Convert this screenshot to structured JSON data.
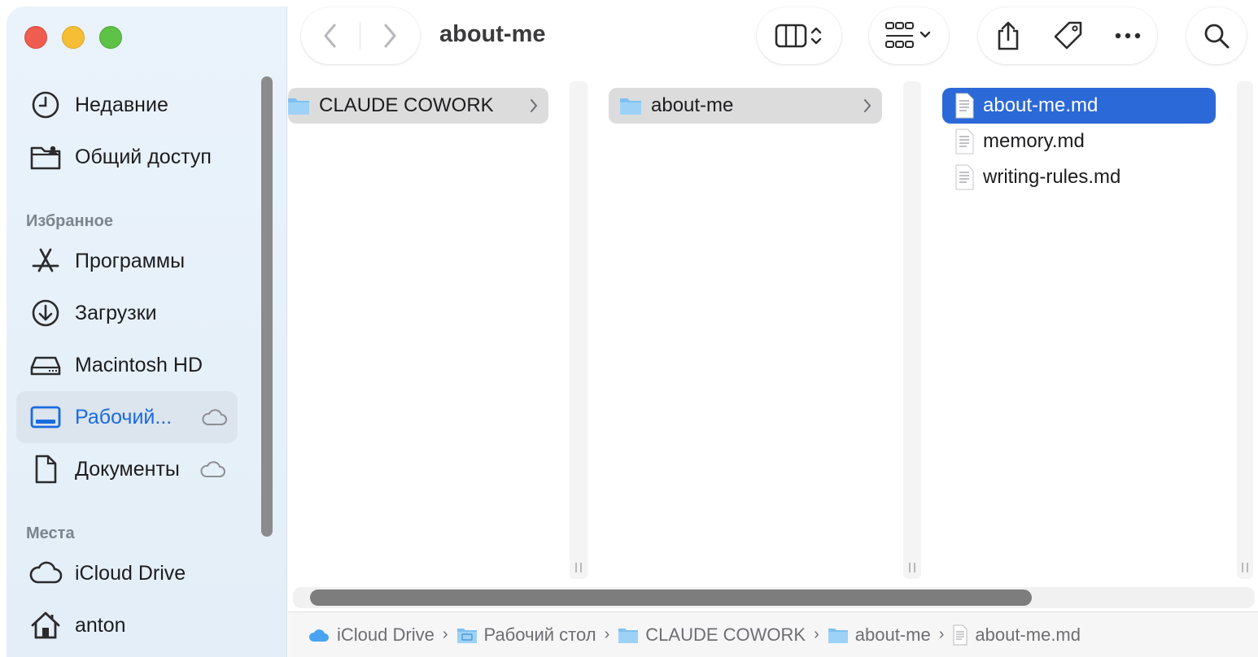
{
  "window": {
    "title": "about-me"
  },
  "colors": {
    "accent": "#1a6be0",
    "selection": "#2c69d8",
    "parent_row": "#dcdcdd"
  },
  "sidebar": {
    "top_items": [
      {
        "label": "Недавние",
        "icon": "clock-icon"
      },
      {
        "label": "Общий доступ",
        "icon": "shared-folder-icon"
      }
    ],
    "favorites_header": "Избранное",
    "favorites": [
      {
        "label": "Программы",
        "icon": "applications-icon"
      },
      {
        "label": "Загрузки",
        "icon": "downloads-icon"
      },
      {
        "label": "Macintosh HD",
        "icon": "hard-drive-icon"
      },
      {
        "label": "Рабочий...",
        "icon": "desktop-icon",
        "active": true,
        "cloud": true
      },
      {
        "label": "Документы",
        "icon": "document-icon",
        "cloud": true
      }
    ],
    "places_header": "Места",
    "places": [
      {
        "label": "iCloud Drive",
        "icon": "icloud-icon"
      },
      {
        "label": "anton",
        "icon": "home-icon"
      }
    ]
  },
  "columns": [
    {
      "items": [
        {
          "name": "CLAUDE COWORK",
          "type": "folder",
          "state": "parent"
        }
      ]
    },
    {
      "items": [
        {
          "name": "about-me",
          "type": "folder",
          "state": "parent"
        }
      ]
    },
    {
      "items": [
        {
          "name": "about-me.md",
          "type": "file",
          "state": "selected"
        },
        {
          "name": "memory.md",
          "type": "file"
        },
        {
          "name": "writing-rules.md",
          "type": "file"
        }
      ]
    }
  ],
  "pathbar": [
    {
      "label": "iCloud Drive",
      "icon": "icloud-icon"
    },
    {
      "label": "Рабочий стол",
      "icon": "desktop-folder-icon"
    },
    {
      "label": "CLAUDE COWORK",
      "icon": "folder-icon"
    },
    {
      "label": "about-me",
      "icon": "folder-icon"
    },
    {
      "label": "about-me.md",
      "icon": "file-icon"
    }
  ],
  "pathbar_separator": "›"
}
